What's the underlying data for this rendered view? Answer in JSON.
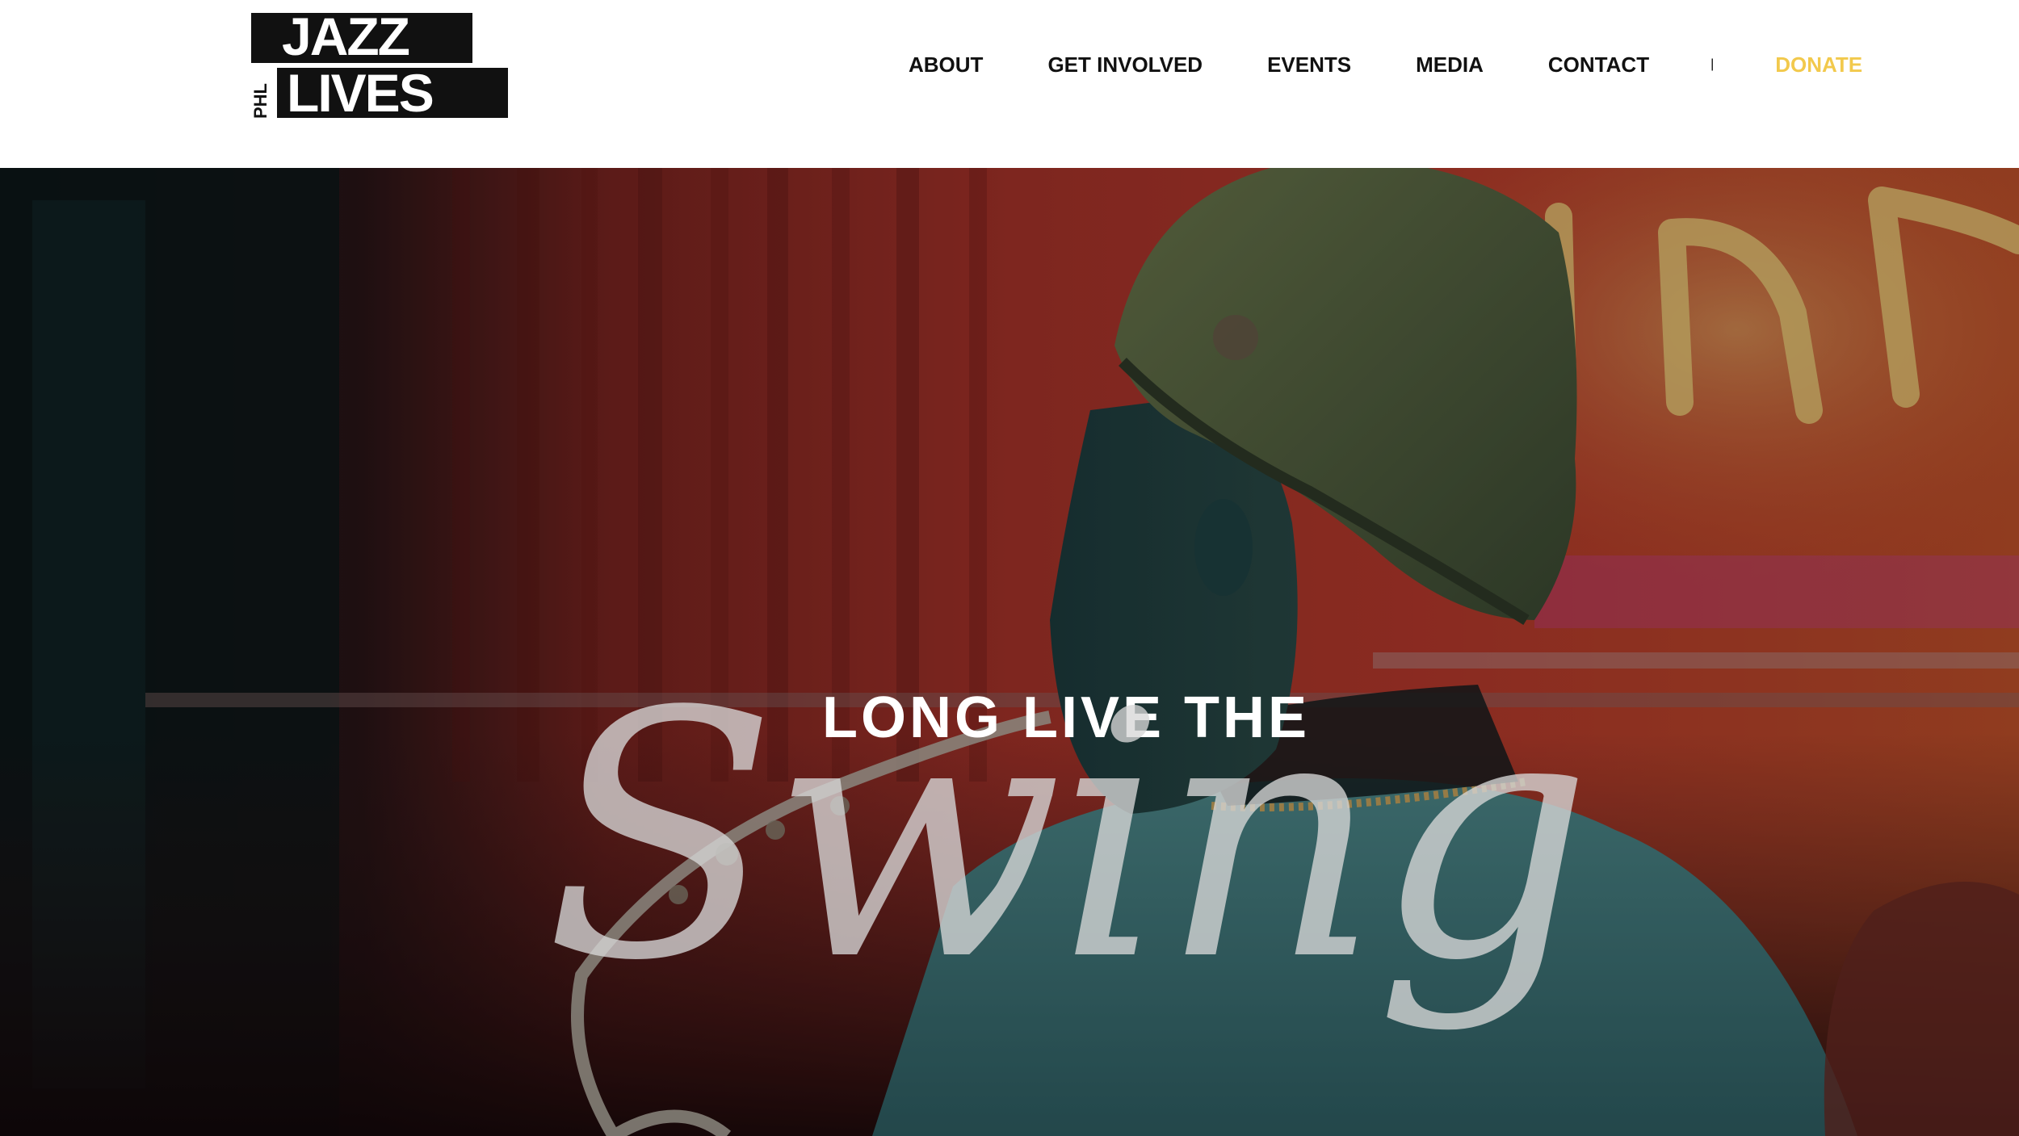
{
  "logo": {
    "top_word": "JAZZ",
    "bottom_word": "LIVES",
    "side_word": "PHL"
  },
  "nav": {
    "items": [
      {
        "label": "ABOUT"
      },
      {
        "label": "GET INVOLVED"
      },
      {
        "label": "EVENTS"
      },
      {
        "label": "MEDIA"
      },
      {
        "label": "CONTACT"
      }
    ],
    "separator": "|",
    "donate": "DONATE"
  },
  "hero": {
    "kicker": "LONG LIVE THE",
    "script": "Swing"
  },
  "colors": {
    "donate_accent": "#f2c94c",
    "nav_text": "#111111",
    "logo_block": "#111111",
    "hero_red": "#b5342a",
    "hero_teal": "#3f8f8f",
    "neon_yellow": "#e8c96a"
  }
}
